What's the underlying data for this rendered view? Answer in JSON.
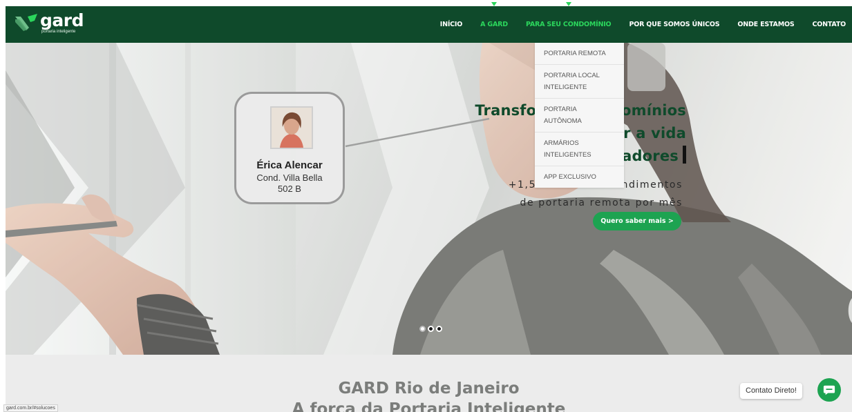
{
  "brand": {
    "name": "gard",
    "tagline": "portaria inteligente",
    "primary_color": "#0f4a2b",
    "accent_color": "#2bd65c",
    "button_color": "#1da351"
  },
  "nav": {
    "items": [
      {
        "label": "INÍCIO"
      },
      {
        "label": "A GARD"
      },
      {
        "label": "PARA SEU CONDOMÍNIO"
      },
      {
        "label": "POR QUE SOMOS ÚNICOS"
      },
      {
        "label": "ONDE ESTAMOS"
      },
      {
        "label": "CONTATO"
      }
    ]
  },
  "dropdown": {
    "items": [
      {
        "label": "PORTARIA REMOTA"
      },
      {
        "label": "PORTARIA LOCAL INTELIGENTE"
      },
      {
        "label": "PORTARIA AUTÔNOMA"
      },
      {
        "label": "ARMÁRIOS INTELIGENTES"
      },
      {
        "label": "APP EXCLUSIVO"
      }
    ]
  },
  "hero": {
    "card": {
      "name": "Érica Alencar",
      "line1": "Cond. Villa Bella",
      "line2": "502 B"
    },
    "headline": {
      "line1": "Transformar condomínios",
      "line2": "e melhorar a vida",
      "line3": "dos moradores"
    },
    "subtext": {
      "line1": "+1,5 milhão de atendimentos",
      "line2": "de portaria remota por mês"
    },
    "cta_label": "Quero saber mais >",
    "slider": {
      "count": 3,
      "active_index": 0
    }
  },
  "section": {
    "title": "GARD Rio de Janeiro",
    "subtitle": "A força da Portaria Inteligente"
  },
  "chat": {
    "label": "Contato Direto!"
  },
  "status_bar": {
    "url": "gard.com.br/#solucoes"
  }
}
